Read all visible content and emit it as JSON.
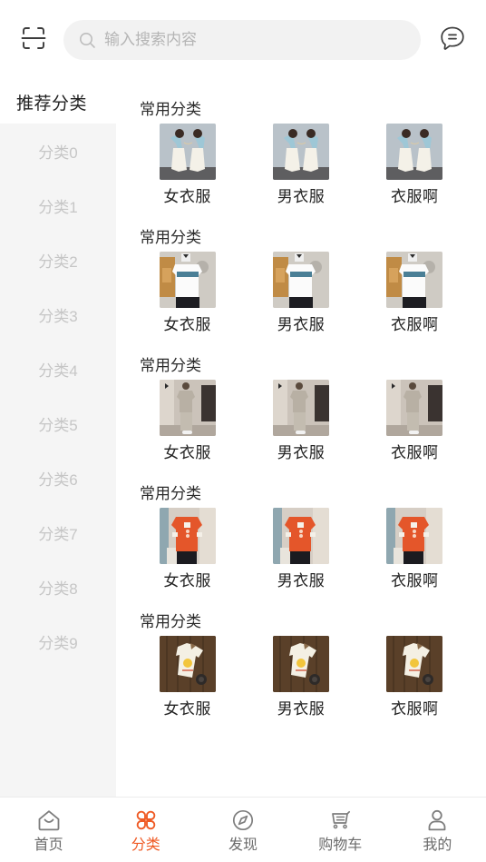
{
  "theme": {
    "accent": "#ef5a24",
    "text_primary": "#222222",
    "text_muted": "#c6c6c6",
    "sidebar_bg": "#f5f5f5",
    "search_bg": "#f2f2f2"
  },
  "header": {
    "scan_icon": "scan-code-icon",
    "search": {
      "icon": "search-icon",
      "placeholder": "输入搜索内容",
      "value": ""
    },
    "message_icon": "message-bubble-icon"
  },
  "sidebar": {
    "title": "推荐分类",
    "items": [
      {
        "label": "分类0"
      },
      {
        "label": "分类1"
      },
      {
        "label": "分类2"
      },
      {
        "label": "分类3"
      },
      {
        "label": "分类4"
      },
      {
        "label": "分类5"
      },
      {
        "label": "分类6"
      },
      {
        "label": "分类7"
      },
      {
        "label": "分类8"
      },
      {
        "label": "分类9"
      }
    ]
  },
  "content": {
    "sections": [
      {
        "title": "常用分类",
        "image": "woman-blue-top-white-skirt",
        "items": [
          {
            "label": "女衣服"
          },
          {
            "label": "男衣服"
          },
          {
            "label": "衣服啊"
          }
        ]
      },
      {
        "title": "常用分类",
        "image": "man-white-sweatshirt-blue-stripe",
        "items": [
          {
            "label": "女衣服"
          },
          {
            "label": "男衣服"
          },
          {
            "label": "衣服啊"
          }
        ]
      },
      {
        "title": "常用分类",
        "image": "man-beige-tracksuit-corridor",
        "items": [
          {
            "label": "女衣服"
          },
          {
            "label": "男衣服"
          },
          {
            "label": "衣服啊"
          }
        ]
      },
      {
        "title": "常用分类",
        "image": "man-orange-chinese-shirt",
        "items": [
          {
            "label": "女衣服"
          },
          {
            "label": "男衣服"
          },
          {
            "label": "衣服啊"
          }
        ]
      },
      {
        "title": "常用分类",
        "image": "white-tshirt-sun-print-wood",
        "items": [
          {
            "label": "女衣服"
          },
          {
            "label": "男衣服"
          },
          {
            "label": "衣服啊"
          }
        ]
      }
    ]
  },
  "tabbar": {
    "active_index": 1,
    "tabs": [
      {
        "label": "首页",
        "icon": "home-icon"
      },
      {
        "label": "分类",
        "icon": "category-grid-icon"
      },
      {
        "label": "发现",
        "icon": "compass-icon"
      },
      {
        "label": "购物车",
        "icon": "shopping-cart-icon"
      },
      {
        "label": "我的",
        "icon": "user-profile-icon"
      }
    ]
  }
}
